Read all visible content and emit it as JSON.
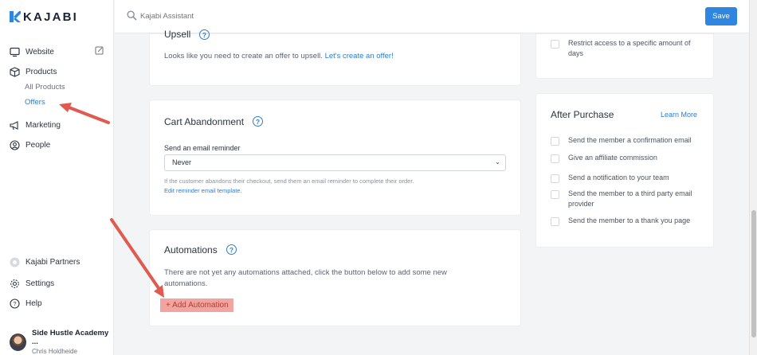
{
  "brand": {
    "logo_text": "KAJABI",
    "accent": "#2f86e0"
  },
  "sidebar": {
    "website": "Website",
    "products": "Products",
    "all_products": "All Products",
    "offers": "Offers",
    "marketing": "Marketing",
    "people": "People",
    "kajabi_partners": "Kajabi Partners",
    "settings": "Settings",
    "help": "Help",
    "user": {
      "site": "Side Hustle Academy ...",
      "name": "Chris Holdheide"
    }
  },
  "topbar": {
    "search_placeholder": "Kajabi Assistant",
    "save_label": "Save"
  },
  "upsell": {
    "title": "Upsell",
    "text": "Looks like you need to create an offer to upsell.",
    "link": "Let's create an offer!"
  },
  "cart_abandonment": {
    "title": "Cart Abandonment",
    "label": "Send an email reminder",
    "selected": "Never",
    "help": "If the customer abandons their checkout, send them an email reminder to complete their order.",
    "link": "Edit reminder email template."
  },
  "automations": {
    "title": "Automations",
    "text_line1": "There are not yet any automations attached, click the button below to add some new",
    "text_line2": "automations.",
    "button": "+ Add Automation"
  },
  "access": {
    "restrict_line1": "Restrict access to a specific amount of",
    "restrict_line2": "days"
  },
  "after_purchase": {
    "title": "After Purchase",
    "learn_more": "Learn More",
    "options": [
      "Send the member a confirmation email",
      "Give an affiliate commission",
      "Send a notification to your team",
      "Send the member to a third party email",
      "provider",
      "Send the member to a thank you page"
    ]
  },
  "annotation_color": "#e05a4f"
}
